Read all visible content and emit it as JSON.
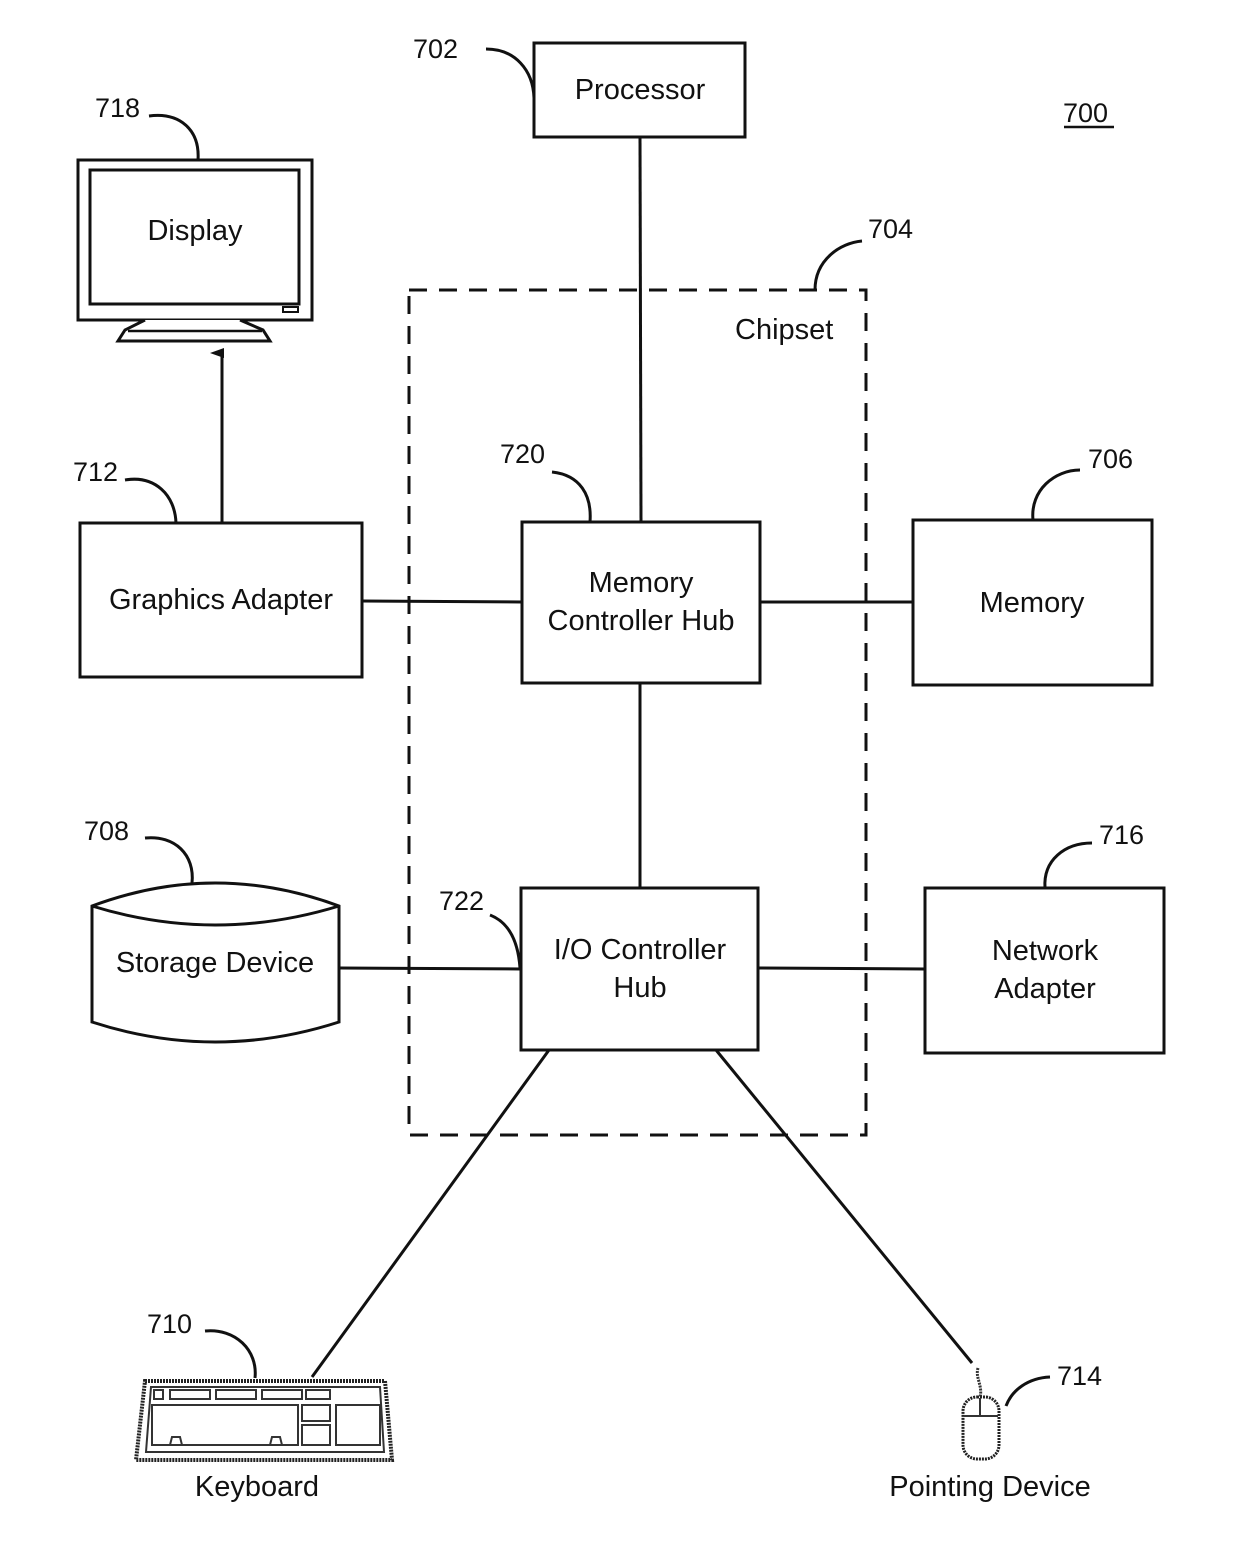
{
  "figure": {
    "number": "700",
    "number_underlined": true,
    "line_color": "#111111",
    "background": "#ffffff"
  },
  "components": {
    "processor": {
      "label": "Processor",
      "ref": "702"
    },
    "chipset": {
      "label": "Chipset",
      "ref": "704"
    },
    "memory": {
      "label": "Memory",
      "ref": "706"
    },
    "storage": {
      "label": "Storage Device",
      "ref": "708"
    },
    "keyboard": {
      "label": "Keyboard",
      "ref": "710"
    },
    "graphics": {
      "label": "Graphics Adapter",
      "ref": "712"
    },
    "pointing": {
      "label": "Pointing Device",
      "ref": "714"
    },
    "network": {
      "label_line1": "Network",
      "label_line2": "Adapter",
      "ref": "716"
    },
    "display": {
      "label": "Display",
      "ref": "718"
    },
    "mch": {
      "label_line1": "Memory",
      "label_line2": "Controller Hub",
      "ref": "720"
    },
    "ioh": {
      "label_line1": "I/O Controller",
      "label_line2": "Hub",
      "ref": "722"
    }
  },
  "connections": [
    {
      "from": "processor",
      "to": "mch"
    },
    {
      "from": "graphics",
      "to": "mch"
    },
    {
      "from": "mch",
      "to": "memory"
    },
    {
      "from": "mch",
      "to": "ioh"
    },
    {
      "from": "storage",
      "to": "ioh"
    },
    {
      "from": "ioh",
      "to": "network"
    },
    {
      "from": "ioh",
      "to": "keyboard"
    },
    {
      "from": "ioh",
      "to": "pointing"
    },
    {
      "from": "graphics",
      "to": "display",
      "arrow": true
    }
  ]
}
